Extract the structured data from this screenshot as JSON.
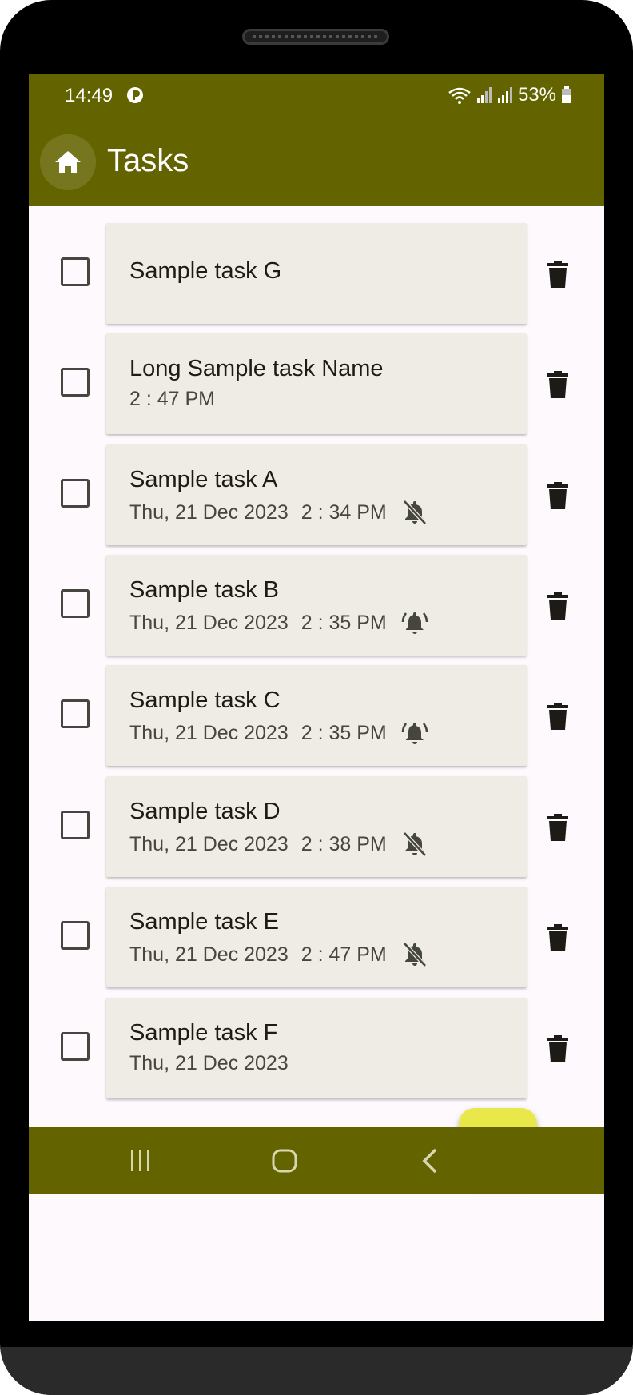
{
  "status": {
    "time": "14:49",
    "battery": "53%"
  },
  "app": {
    "title": "Tasks"
  },
  "tasks": [
    {
      "name": "Sample task G",
      "date": "",
      "time": "",
      "bell": "none"
    },
    {
      "name": "Long Sample task Name",
      "date": "",
      "time": "2 : 47 PM",
      "bell": "none"
    },
    {
      "name": "Sample task A",
      "date": "Thu, 21 Dec 2023",
      "time": "2 : 34 PM",
      "bell": "bell-off-icon"
    },
    {
      "name": "Sample task B",
      "date": "Thu, 21 Dec 2023",
      "time": "2 : 35 PM",
      "bell": "bell-ringing-icon"
    },
    {
      "name": "Sample task C",
      "date": "Thu, 21 Dec 2023",
      "time": "2 : 35 PM",
      "bell": "bell-ringing-icon"
    },
    {
      "name": "Sample task D",
      "date": "Thu, 21 Dec 2023",
      "time": "2 : 38 PM",
      "bell": "bell-off-icon"
    },
    {
      "name": "Sample task E",
      "date": "Thu, 21 Dec 2023",
      "time": "2 : 47 PM",
      "bell": "bell-off-icon"
    },
    {
      "name": "Sample task F",
      "date": "Thu, 21 Dec 2023",
      "time": "",
      "bell": "none"
    }
  ],
  "fab": {
    "icon": "plus-icon"
  },
  "navbar": {
    "icons": [
      "recent-apps-icon",
      "home-nav-icon",
      "back-icon"
    ]
  },
  "colors": {
    "primary": "#636300",
    "card": "#efebe5",
    "fab": "#e8e84a",
    "background": "#fdf9fd"
  }
}
